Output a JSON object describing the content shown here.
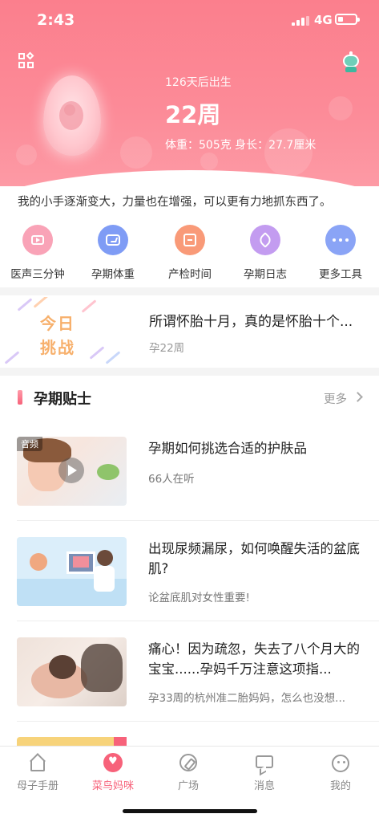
{
  "status_bar": {
    "time": "2:43",
    "network": "4G"
  },
  "pregnancy": {
    "countdown": "126天后出生",
    "weeks": "22周",
    "size": "体重：505克 身长：27.7厘米",
    "description": "我的小手逐渐变大，力量也在增强，可以更有力地抓东西了。"
  },
  "tools": [
    {
      "label": "医声三分钟",
      "icon": "tv-icon",
      "color": "#f9a3b7"
    },
    {
      "label": "孕期体重",
      "icon": "scale-icon",
      "color": "#7f9cf5"
    },
    {
      "label": "产检时间",
      "icon": "calendar-icon",
      "color": "#f99a78"
    },
    {
      "label": "孕期日志",
      "icon": "pen-icon",
      "color": "#c39cf0"
    },
    {
      "label": "更多工具",
      "icon": "more-icon",
      "color": "#8aa4f6"
    }
  ],
  "challenge": {
    "art_line1": "今日",
    "art_line2": "挑战",
    "title": "所谓怀胎十月，真的是怀胎十个...",
    "subtitle": "孕22周"
  },
  "tips": {
    "title": "孕期贴士",
    "more": "更多",
    "articles": [
      {
        "title": "孕期如何挑选合适的护肤品",
        "subtitle": "66人在听",
        "badge": "音频"
      },
      {
        "title": "出现尿频漏尿，如何唤醒失活的盆底肌?",
        "subtitle": "论盆底肌对女性重要!"
      },
      {
        "title": "痛心！因为疏忽，失去了八个月大的宝宝......孕妈千万注意这项指...",
        "subtitle": "孕33周的杭州准二胎妈妈，怎么也没想..."
      }
    ]
  },
  "tabs": [
    {
      "label": "母子手册",
      "icon": "home-icon",
      "active": false
    },
    {
      "label": "菜鸟妈咪",
      "icon": "heart-icon",
      "active": true
    },
    {
      "label": "广场",
      "icon": "compass-icon",
      "active": false
    },
    {
      "label": "消息",
      "icon": "chat-icon",
      "active": false
    },
    {
      "label": "我的",
      "icon": "profile-icon",
      "active": false
    }
  ],
  "colors": {
    "brand": "#f7627a",
    "header": "#fb7f8d",
    "accent_orange": "#f7b06c"
  }
}
